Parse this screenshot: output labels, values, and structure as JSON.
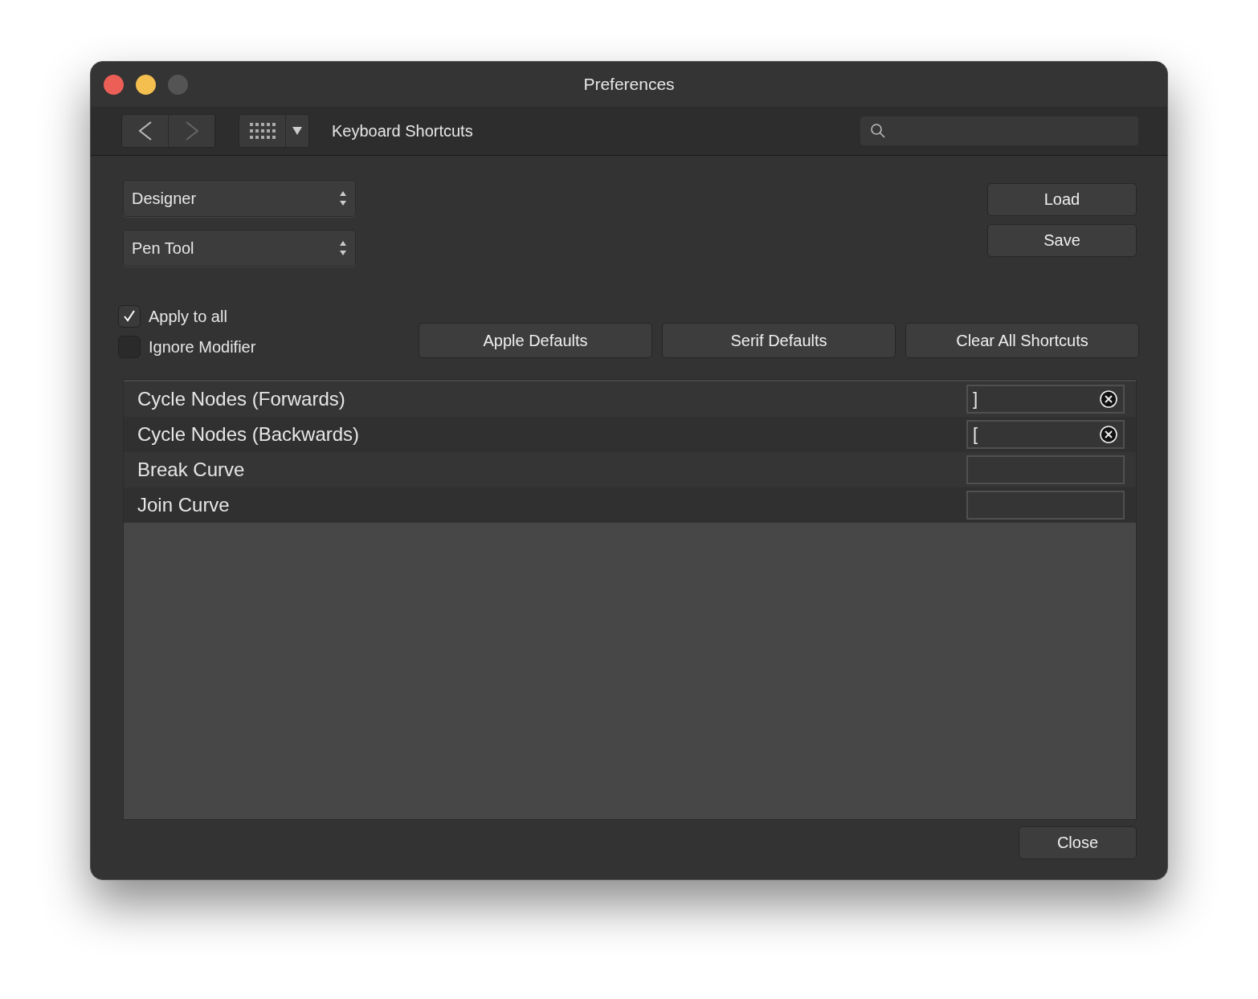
{
  "window": {
    "title": "Preferences"
  },
  "toolbar": {
    "title": "Keyboard Shortcuts"
  },
  "dropdowns": [
    {
      "value": "Designer"
    },
    {
      "value": "Pen Tool"
    }
  ],
  "file_buttons": [
    "Load",
    "Save"
  ],
  "checkboxes": [
    {
      "label": "Apply to all",
      "checked": true
    },
    {
      "label": "Ignore Modifier",
      "checked": false
    }
  ],
  "default_buttons": [
    "Apple Defaults",
    "Serif Defaults",
    "Clear All Shortcuts"
  ],
  "shortcuts": [
    {
      "name": "Cycle Nodes (Forwards)",
      "key": "]"
    },
    {
      "name": "Cycle Nodes (Backwards)",
      "key": "["
    },
    {
      "name": "Break Curve"
    },
    {
      "name": "Join Curve"
    }
  ],
  "close_button": "Close"
}
